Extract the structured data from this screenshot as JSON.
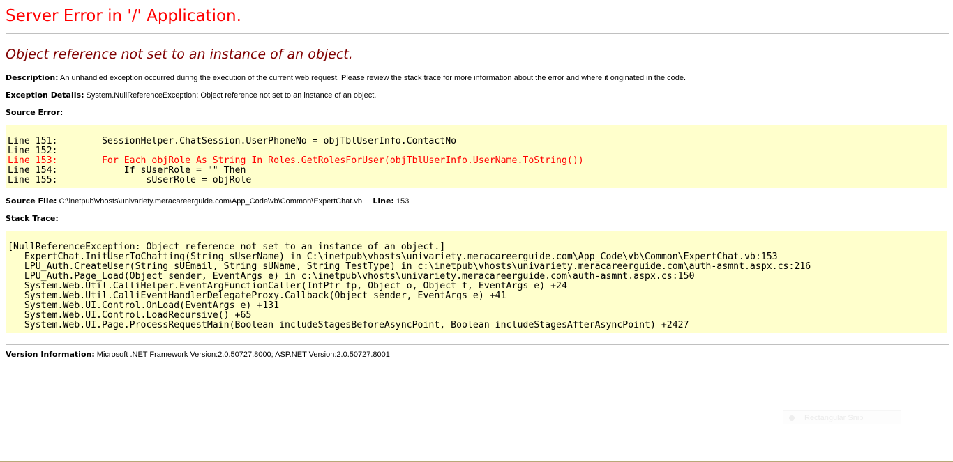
{
  "title": "Server Error in '/' Application.",
  "subtitle": "Object reference not set to an instance of an object.",
  "description": {
    "label": "Description:",
    "text": "An unhandled exception occurred during the execution of the current web request. Please review the stack trace for more information about the error and where it originated in the code."
  },
  "exception_details": {
    "label": "Exception Details:",
    "text": "System.NullReferenceException: Object reference not set to an instance of an object."
  },
  "source_error": {
    "label": "Source Error:",
    "lines": [
      "Line 151:        SessionHelper.ChatSession.UserPhoneNo = objTblUserInfo.ContactNo",
      "Line 152:",
      "Line 153:        For Each objRole As String In Roles.GetRolesForUser(objTblUserInfo.UserName.ToString())",
      "Line 154:            If sUserRole = \"\" Then",
      "Line 155:                sUserRole = objRole"
    ],
    "error_line": "Line 153:"
  },
  "source_file": {
    "label": "Source File:",
    "path": "C:\\inetpub\\vhosts\\univariety.meracareerguide.com\\App_Code\\vb\\Common\\ExpertChat.vb",
    "line_label": "Line:",
    "line_number": "153"
  },
  "stack_trace": {
    "label": "Stack Trace:",
    "lines": [
      "[NullReferenceException: Object reference not set to an instance of an object.]",
      "   ExpertChat.InitUserToChatting(String sUserName) in C:\\inetpub\\vhosts\\univariety.meracareerguide.com\\App_Code\\vb\\Common\\ExpertChat.vb:153",
      "   LPU_Auth.CreateUser(String sUEmail, String sUName, String TestType) in c:\\inetpub\\vhosts\\univariety.meracareerguide.com\\auth-asmnt.aspx.cs:216",
      "   LPU_Auth.Page_Load(Object sender, EventArgs e) in c:\\inetpub\\vhosts\\univariety.meracareerguide.com\\auth-asmnt.aspx.cs:150",
      "   System.Web.Util.CalliHelper.EventArgFunctionCaller(IntPtr fp, Object o, Object t, EventArgs e) +24",
      "   System.Web.Util.CalliEventHandlerDelegateProxy.Callback(Object sender, EventArgs e) +41",
      "   System.Web.UI.Control.OnLoad(EventArgs e) +131",
      "   System.Web.UI.Control.LoadRecursive() +65",
      "   System.Web.UI.Page.ProcessRequestMain(Boolean includeStagesBeforeAsyncPoint, Boolean includeStagesAfterAsyncPoint) +2427"
    ]
  },
  "version_information": {
    "label": "Version Information:",
    "text": "Microsoft .NET Framework Version:2.0.50727.8000; ASP.NET Version:2.0.50727.8001"
  },
  "overlay": {
    "label": "Rectangular Snip",
    "icon": "scissors-icon"
  },
  "colors": {
    "title": "#ff0000",
    "subtitle": "#800000",
    "code_background": "#ffffcc",
    "error_line": "#ff0000",
    "rule": "#c0c0c0"
  }
}
